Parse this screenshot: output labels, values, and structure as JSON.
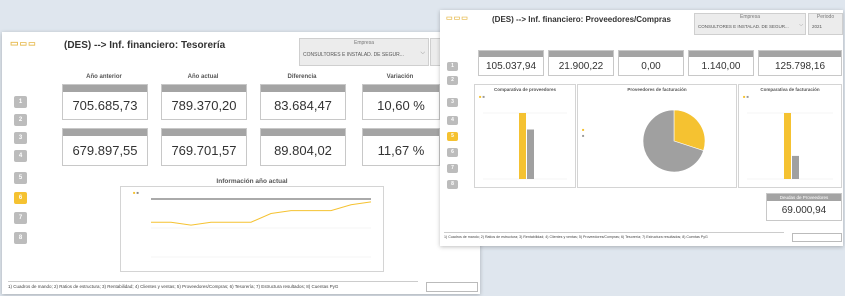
{
  "left_page": {
    "title": "(DES) --> Inf. financiero: Tesorería",
    "dropdown_value": "CONSULTORES E INSTALAD. DE SEGUR...",
    "nav_buttons": [
      "1",
      "2",
      "3",
      "4",
      "5",
      "6",
      "7",
      "8"
    ],
    "active_nav": "6",
    "columns": [
      "Año anterior",
      "Año actual",
      "Diferencia",
      "Variación"
    ],
    "kpis_row1": [
      {
        "value": "705.685,73"
      },
      {
        "value": "789.370,20"
      },
      {
        "value": "83.684,47"
      },
      {
        "value": "10,60 %"
      }
    ],
    "kpis_row2": [
      {
        "value": "679.897,55"
      },
      {
        "value": "769.701,57"
      },
      {
        "value": "89.804,02"
      },
      {
        "value": "11,67 %"
      }
    ],
    "chart_title": "Información año actual",
    "footer": "1) Cuadros de mando; 2) Ratios de estructura; 3) Rentabilidad; 4) Clientes y ventas; 5) Proveedores/Compras; 6) Tesorería; 7) Estructura resultados; 8) Cuentas PyG"
  },
  "right_page": {
    "title": "(DES) --> Inf. financiero: Proveedores/Compras",
    "dropdown_value": "CONSULTORES E INSTALAD. DE SEGUR...",
    "dropdown2_value": "2021",
    "nav_buttons": [
      "1",
      "2",
      "3",
      "4",
      "5",
      "6",
      "7",
      "8"
    ],
    "active_nav": "5",
    "kpis": [
      {
        "value": "105.037,94"
      },
      {
        "value": "21.900,22"
      },
      {
        "value": "0,00"
      },
      {
        "value": "1.140,00"
      },
      {
        "value": "125.798,16"
      }
    ],
    "chart1_title": "Comparativa de proveedores",
    "chart2_title": "Proveedores de facturación",
    "chart3_title": "Comparativa de facturación",
    "debt_label": "Deudas de Proveedores",
    "debt_value": "69.000,94",
    "footer": "1) Cuadros de mando; 2) Ratios de estructura; 3) Rentabilidad; 4) Clientes y ventas; 5) Proveedores/Compras; 6) Tesorería; 7) Estructura resultados; 8) Cuentas PyG"
  },
  "colors": {
    "accent": "#f5c231",
    "header_gray": "#a4a4a4",
    "bar_gray": "#a0a0a0"
  },
  "chart_data": [
    {
      "type": "line",
      "title": "Información año actual",
      "series": [
        {
          "values": [
            1,
            1,
            1,
            1,
            1,
            1,
            1,
            1,
            1,
            1,
            1,
            1
          ]
        },
        {
          "values": [
            0.6,
            0.6,
            0.55,
            0.6,
            0.6,
            0.6,
            0.75,
            0.8,
            0.8,
            0.8,
            0.9,
            0.95
          ]
        }
      ]
    },
    {
      "type": "bar",
      "title": "Comparativa de proveedores",
      "series": [
        {
          "values": [
            1
          ]
        },
        {
          "values": [
            0.75
          ]
        }
      ]
    },
    {
      "type": "pie",
      "title": "Proveedores de facturación",
      "values": [
        0.3,
        0.7
      ]
    },
    {
      "type": "bar",
      "title": "Comparativa de facturación",
      "series": [
        {
          "values": [
            1
          ]
        },
        {
          "values": [
            0.35
          ]
        }
      ]
    }
  ]
}
